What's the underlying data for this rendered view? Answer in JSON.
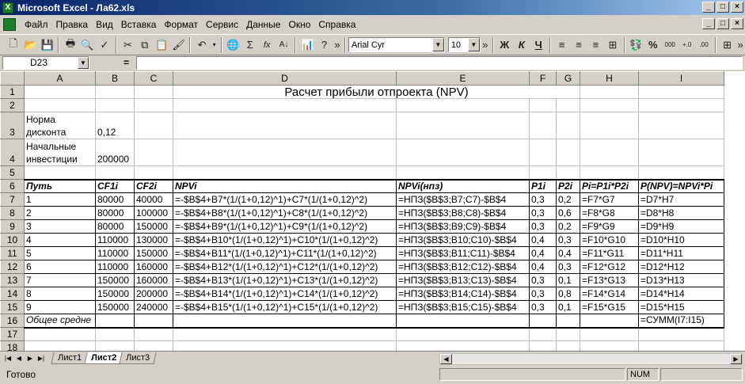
{
  "window": {
    "title": "Microsoft Excel - Ла62.xls",
    "min": "_",
    "max": "□",
    "close": "×"
  },
  "menu": [
    "Файл",
    "Правка",
    "Вид",
    "Вставка",
    "Формат",
    "Сервис",
    "Данные",
    "Окно",
    "Справка"
  ],
  "toolbar": {
    "font_name": "Arial Cyr",
    "font_size": "10",
    "bold": "Ж",
    "italic": "К",
    "underline": "Ч",
    "percent": "%",
    "thousands": "000",
    "autosum": "Σ",
    "function": "fx"
  },
  "formula_bar": {
    "name_box": "D23",
    "equals": "=",
    "value": ""
  },
  "columns": [
    "A",
    "B",
    "C",
    "D",
    "E",
    "F",
    "G",
    "H",
    "I"
  ],
  "rows": {
    "r1": {
      "title": "Расчет прибыли отпроекта (NPV)"
    },
    "r3": {
      "a": "Норма дисконта",
      "b": "0,12"
    },
    "r4": {
      "a": "Начальные инвестиции",
      "b": "200000"
    },
    "r6": {
      "a": "Путь",
      "b": "CF1i",
      "c": "CF2i",
      "d": "NPVi",
      "e": "NPVi(нпз)",
      "f": "P1i",
      "g": "P2i",
      "h": "Pi=P1i*P2i",
      "i": "P(NPV)=NPVi*Pi"
    },
    "data": [
      {
        "n": "7",
        "a": "1",
        "b": "80000",
        "c": "40000",
        "d": "=-$B$4+B7*(1/(1+0,12)^1)+C7*(1/(1+0,12)^2)",
        "e": "=НПЗ($B$3;B7;C7)-$B$4",
        "f": "0,3",
        "g": "0,2",
        "h": "=F7*G7",
        "i": "=D7*H7"
      },
      {
        "n": "8",
        "a": "2",
        "b": "80000",
        "c": "100000",
        "d": "=-$B$4+B8*(1/(1+0,12)^1)+C8*(1/(1+0,12)^2)",
        "e": "=НПЗ($B$3;B8;C8)-$B$4",
        "f": "0,3",
        "g": "0,6",
        "h": "=F8*G8",
        "i": "=D8*H8"
      },
      {
        "n": "9",
        "a": "3",
        "b": "80000",
        "c": "150000",
        "d": "=-$B$4+B9*(1/(1+0,12)^1)+C9*(1/(1+0,12)^2)",
        "e": "=НПЗ($B$3;B9;C9)-$B$4",
        "f": "0,3",
        "g": "0,2",
        "h": "=F9*G9",
        "i": "=D9*H9"
      },
      {
        "n": "10",
        "a": "4",
        "b": "110000",
        "c": "130000",
        "d": "=-$B$4+B10*(1/(1+0,12)^1)+C10*(1/(1+0,12)^2)",
        "e": "=НПЗ($B$3;B10;C10)-$B$4",
        "f": "0,4",
        "g": "0,3",
        "h": "=F10*G10",
        "i": "=D10*H10"
      },
      {
        "n": "11",
        "a": "5",
        "b": "110000",
        "c": "150000",
        "d": "=-$B$4+B11*(1/(1+0,12)^1)+C11*(1/(1+0,12)^2)",
        "e": "=НПЗ($B$3;B11;C11)-$B$4",
        "f": "0,4",
        "g": "0,4",
        "h": "=F11*G11",
        "i": "=D11*H11"
      },
      {
        "n": "12",
        "a": "6",
        "b": "110000",
        "c": "160000",
        "d": "=-$B$4+B12*(1/(1+0,12)^1)+C12*(1/(1+0,12)^2)",
        "e": "=НПЗ($B$3;B12;C12)-$B$4",
        "f": "0,4",
        "g": "0,3",
        "h": "=F12*G12",
        "i": "=D12*H12"
      },
      {
        "n": "13",
        "a": "7",
        "b": "150000",
        "c": "160000",
        "d": "=-$B$4+B13*(1/(1+0,12)^1)+C13*(1/(1+0,12)^2)",
        "e": "=НПЗ($B$3;B13;C13)-$B$4",
        "f": "0,3",
        "g": "0,1",
        "h": "=F13*G13",
        "i": "=D13*H13"
      },
      {
        "n": "14",
        "a": "8",
        "b": "150000",
        "c": "200000",
        "d": "=-$B$4+B14*(1/(1+0,12)^1)+C14*(1/(1+0,12)^2)",
        "e": "=НПЗ($B$3;B14;C14)-$B$4",
        "f": "0,3",
        "g": "0,8",
        "h": "=F14*G14",
        "i": "=D14*H14"
      },
      {
        "n": "15",
        "a": "9",
        "b": "150000",
        "c": "240000",
        "d": "=-$B$4+B15*(1/(1+0,12)^1)+C15*(1/(1+0,12)^2)",
        "e": "=НПЗ($B$3;B15;C15)-$B$4",
        "f": "0,3",
        "g": "0,1",
        "h": "=F15*G15",
        "i": "=D15*H15"
      }
    ],
    "r16": {
      "a": "Общее средне",
      "i": "=СУММ(I7:I15)"
    }
  },
  "sheets": [
    {
      "name": "Лист1",
      "active": false
    },
    {
      "name": "Лист2",
      "active": true
    },
    {
      "name": "Лист3",
      "active": false
    }
  ],
  "status": {
    "text": "Готово",
    "num": "NUM"
  }
}
